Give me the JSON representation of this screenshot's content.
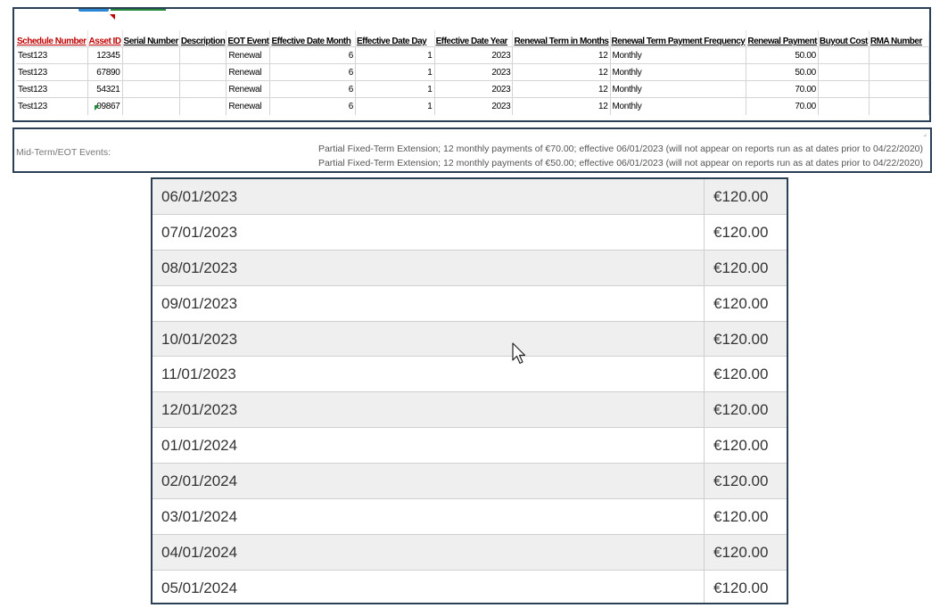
{
  "sheet": {
    "headers": [
      "Schedule Number",
      "Asset ID",
      "Serial Number",
      "Description",
      "EOT Event",
      "Effective Date Month",
      "Effective Date Day",
      "Effective Date Year",
      "Renewal Term in Months",
      "Renewal Term Payment Frequency",
      "Renewal Payment",
      "Buyout Cost",
      "RMA Number"
    ],
    "rows": [
      [
        "Test123",
        "12345",
        "",
        "",
        "Renewal",
        "6",
        "1",
        "2023",
        "12",
        "Monthly",
        "50.00",
        "",
        ""
      ],
      [
        "Test123",
        "67890",
        "",
        "",
        "Renewal",
        "6",
        "1",
        "2023",
        "12",
        "Monthly",
        "50.00",
        "",
        ""
      ],
      [
        "Test123",
        "54321",
        "",
        "",
        "Renewal",
        "6",
        "1",
        "2023",
        "12",
        "Monthly",
        "70.00",
        "",
        ""
      ],
      [
        "Test123",
        "09867",
        "",
        "",
        "Renewal",
        "6",
        "1",
        "2023",
        "12",
        "Monthly",
        "70.00",
        "",
        ""
      ]
    ]
  },
  "events": {
    "label": "Mid-Term/EOT Events:",
    "line1": "Partial Fixed-Term Extension; 12 monthly payments of €70.00; effective 06/01/2023 (will not appear on reports run as at dates prior to 04/22/2020)",
    "line2": "Partial Fixed-Term Extension; 12 monthly payments of €50.00; effective 06/01/2023 (will not appear on reports run as at dates prior to 04/22/2020)"
  },
  "schedule": {
    "rows": [
      {
        "date": "06/01/2023",
        "amount": "€120.00"
      },
      {
        "date": "07/01/2023",
        "amount": "€120.00"
      },
      {
        "date": "08/01/2023",
        "amount": "€120.00"
      },
      {
        "date": "09/01/2023",
        "amount": "€120.00"
      },
      {
        "date": "10/01/2023",
        "amount": "€120.00"
      },
      {
        "date": "11/01/2023",
        "amount": "€120.00"
      },
      {
        "date": "12/01/2023",
        "amount": "€120.00"
      },
      {
        "date": "01/01/2024",
        "amount": "€120.00"
      },
      {
        "date": "02/01/2024",
        "amount": "€120.00"
      },
      {
        "date": "03/01/2024",
        "amount": "€120.00"
      },
      {
        "date": "04/01/2024",
        "amount": "€120.00"
      },
      {
        "date": "05/01/2024",
        "amount": "€120.00"
      }
    ]
  }
}
